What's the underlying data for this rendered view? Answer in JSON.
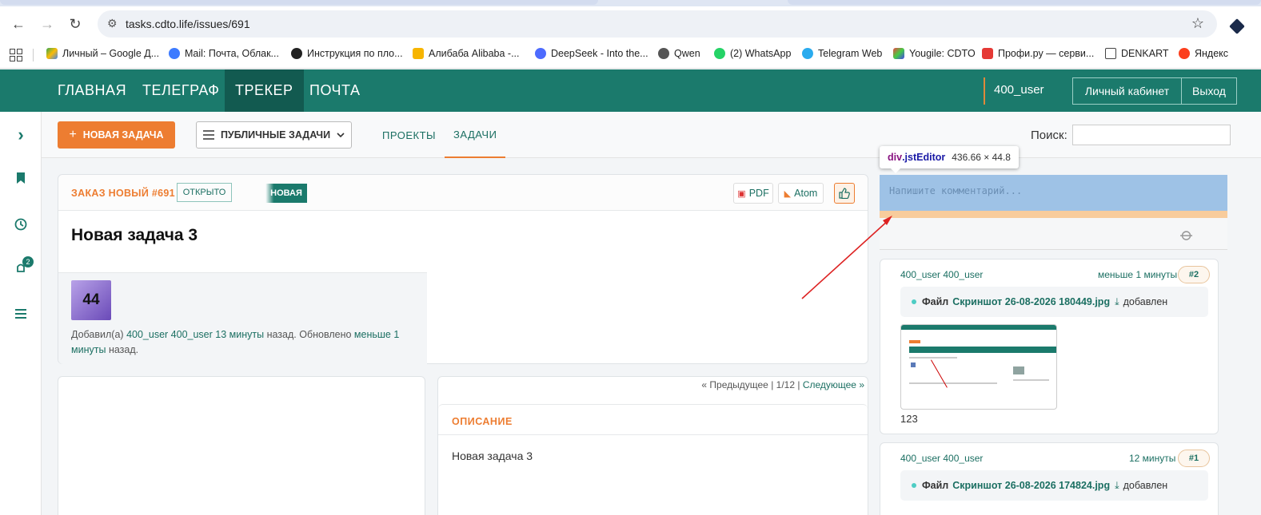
{
  "browser": {
    "url": "tasks.cdto.life/issues/691",
    "bookmarks": [
      "Личный – Google Д...",
      "Mail: Почта, Облак...",
      "Инструкция по пло...",
      "Алибаба Alibaba -...",
      "DeepSeek - Into the...",
      "Qwen",
      "(2) WhatsApp",
      "Telegram Web",
      "Yougile: CDTO",
      "Профи.ру — серви...",
      "DENKART",
      "Яндекс"
    ]
  },
  "site_nav": {
    "items": [
      "ГЛАВНАЯ",
      "ТЕЛЕГРАФ",
      "ТРЕКЕР",
      "ПОЧТА"
    ],
    "active": "ТРЕКЕР",
    "user": "400_user",
    "cabinet": "Личный кабинет",
    "logout": "Выход"
  },
  "sidebar": {
    "badge": "2"
  },
  "subheader": {
    "new_task": "НОВАЯ ЗАДАЧА",
    "public_tasks": "ПУБЛИЧНЫЕ ЗАДАЧИ",
    "tabs": [
      "ПРОЕКТЫ",
      "ЗАДАЧИ"
    ],
    "active_tab": "ЗАДАЧИ",
    "search_label": "Поиск:"
  },
  "issue": {
    "id_label": "ЗАКАЗ НОВЫЙ #691",
    "status": "ОТКРЫТО",
    "state": "НОВАЯ",
    "pdf": "PDF",
    "atom": "Atom",
    "title": "Новая задача 3",
    "avatar_text": "44",
    "added_by_prefix": "Добавил(а)",
    "author": "400_user 400_user",
    "created": "13 минуты",
    "ago1": "назад. Обновлено",
    "updated_a": "меньше 1",
    "updated_b": "минуты",
    "ago2": "назад."
  },
  "pager": {
    "prev": "« Предыдущее",
    "pos": "1/12",
    "next": "Следующее »"
  },
  "description": {
    "title": "ОПИСАНИЕ",
    "text": "Новая задача 3"
  },
  "devtools": {
    "tag": "div",
    "cls": ".jstEditor",
    "dims": "436.66 × 44.8"
  },
  "comment_form": {
    "placeholder": "Напишите комментарий..."
  },
  "comments": [
    {
      "author": "400_user 400_user",
      "time": "меньше 1 минуты",
      "num": "#2",
      "file_label": "Файл",
      "file_name": "Скриншот 26-08-2026 180449.jpg",
      "added": "добавлен",
      "caption": "123"
    },
    {
      "author": "400_user 400_user",
      "time": "12 минуты",
      "num": "#1",
      "file_label": "Файл",
      "file_name": "Скриншот 26-08-2026 174824.jpg",
      "added": "добавлен"
    }
  ],
  "colors": {
    "brand": "#1b7a6c",
    "accent": "#ed7d31"
  }
}
